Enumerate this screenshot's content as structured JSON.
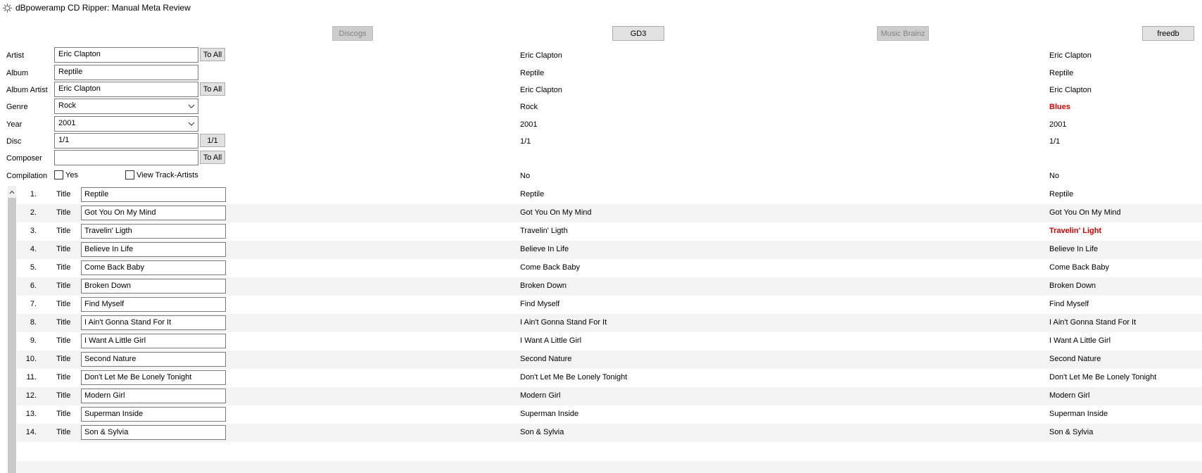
{
  "window": {
    "title": "dBpoweramp CD Ripper: Manual Meta Review"
  },
  "sources": {
    "discogs": "Discogs",
    "gd3": "GD3",
    "musicbrainz": "Music Brainz",
    "freedb": "freedb"
  },
  "fields": {
    "artist": {
      "label": "Artist",
      "value": "Eric Clapton",
      "button": "To All",
      "gd3": "Eric Clapton",
      "freedb": "Eric Clapton"
    },
    "album": {
      "label": "Album",
      "value": "Reptile",
      "gd3": "Reptile",
      "freedb": "Reptile"
    },
    "album_artist": {
      "label": "Album Artist",
      "value": "Eric Clapton",
      "button": "To All",
      "gd3": "Eric Clapton",
      "freedb": "Eric Clapton"
    },
    "genre": {
      "label": "Genre",
      "value": "Rock",
      "gd3": "Rock",
      "freedb": "Blues"
    },
    "year": {
      "label": "Year",
      "value": "2001",
      "gd3": "2001",
      "freedb": "2001"
    },
    "disc": {
      "label": "Disc",
      "value": "1/1",
      "button": "1/1",
      "gd3": "1/1",
      "freedb": "1/1"
    },
    "composer": {
      "label": "Composer",
      "value": "",
      "button": "To All"
    },
    "compilation": {
      "label": "Compilation",
      "yes_label": "Yes",
      "view_track_artists_label": "View Track-Artists",
      "gd3": "No",
      "freedb": "No"
    }
  },
  "highlight_color": "#e00000",
  "tracks": [
    {
      "num": "1.",
      "label": "Title",
      "value": "Reptile",
      "gd3": "Reptile",
      "freedb": "Reptile",
      "freedb_diff": false
    },
    {
      "num": "2.",
      "label": "Title",
      "value": "Got You On My Mind",
      "gd3": "Got You On My Mind",
      "freedb": "Got You On My Mind",
      "freedb_diff": false
    },
    {
      "num": "3.",
      "label": "Title",
      "value": "Travelin' Ligth",
      "gd3": "Travelin' Ligth",
      "freedb": "Travelin' Light",
      "freedb_diff": true
    },
    {
      "num": "4.",
      "label": "Title",
      "value": "Believe In Life",
      "gd3": "Believe In Life",
      "freedb": "Believe In Life",
      "freedb_diff": false
    },
    {
      "num": "5.",
      "label": "Title",
      "value": "Come Back Baby",
      "gd3": "Come Back Baby",
      "freedb": "Come Back Baby",
      "freedb_diff": false
    },
    {
      "num": "6.",
      "label": "Title",
      "value": "Broken Down",
      "gd3": "Broken Down",
      "freedb": "Broken Down",
      "freedb_diff": false
    },
    {
      "num": "7.",
      "label": "Title",
      "value": "Find Myself",
      "gd3": "Find Myself",
      "freedb": "Find Myself",
      "freedb_diff": false
    },
    {
      "num": "8.",
      "label": "Title",
      "value": "I Ain't Gonna Stand For It",
      "gd3": "I Ain't Gonna Stand For It",
      "freedb": "I Ain't Gonna Stand For It",
      "freedb_diff": false
    },
    {
      "num": "9.",
      "label": "Title",
      "value": "I Want A Little Girl",
      "gd3": "I Want A Little Girl",
      "freedb": "I Want A Little Girl",
      "freedb_diff": false
    },
    {
      "num": "10.",
      "label": "Title",
      "value": "Second Nature",
      "gd3": "Second Nature",
      "freedb": "Second Nature",
      "freedb_diff": false
    },
    {
      "num": "11.",
      "label": "Title",
      "value": "Don't Let Me Be Lonely Tonight",
      "gd3": "Don't Let Me Be Lonely Tonight",
      "freedb": "Don't Let Me Be Lonely Tonight",
      "freedb_diff": false
    },
    {
      "num": "12.",
      "label": "Title",
      "value": "Modern Girl",
      "gd3": "Modern Girl",
      "freedb": "Modern Girl",
      "freedb_diff": false
    },
    {
      "num": "13.",
      "label": "Title",
      "value": "Superman Inside",
      "gd3": "Superman Inside",
      "freedb": "Superman Inside",
      "freedb_diff": false
    },
    {
      "num": "14.",
      "label": "Title",
      "value": "Son & Sylvia",
      "gd3": "Son & Sylvia",
      "freedb": "Son & Sylvia",
      "freedb_diff": false
    }
  ]
}
